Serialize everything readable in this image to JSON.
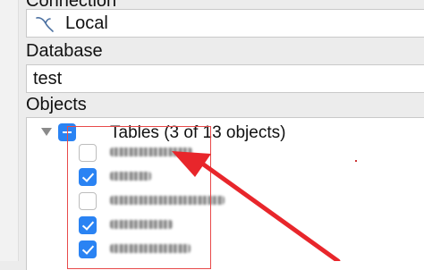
{
  "connection": {
    "label": "Connection",
    "value": "Local",
    "icon": "mysql-dolphin-icon"
  },
  "database": {
    "label": "Database",
    "value": "test"
  },
  "objects": {
    "label": "Objects",
    "root": {
      "label": "Tables (3 of 13 objects)",
      "expanded": true,
      "state": "partial"
    },
    "items": [
      {
        "checked": false
      },
      {
        "checked": true
      },
      {
        "checked": false
      },
      {
        "checked": true
      },
      {
        "checked": true
      }
    ]
  },
  "annotation": {
    "color": "#e8262b"
  }
}
